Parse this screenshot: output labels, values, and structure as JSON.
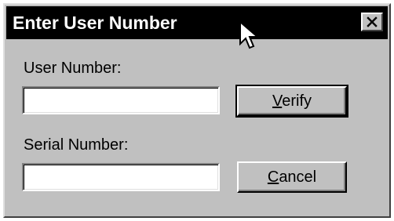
{
  "dialog": {
    "title": "Enter User Number",
    "close_icon": "close-icon"
  },
  "form": {
    "user_number_label": "User Number:",
    "user_number_value": "",
    "serial_number_label": "Serial Number:",
    "serial_number_value": ""
  },
  "buttons": {
    "verify": {
      "mnemonic": "V",
      "rest": "erify"
    },
    "cancel": {
      "mnemonic": "C",
      "rest": "ancel"
    }
  },
  "cursor": {
    "icon": "mouse-pointer-icon"
  },
  "colors": {
    "title_bar": "#000000",
    "title_text": "#ffffff",
    "dialog_face": "#c0c0c0"
  }
}
